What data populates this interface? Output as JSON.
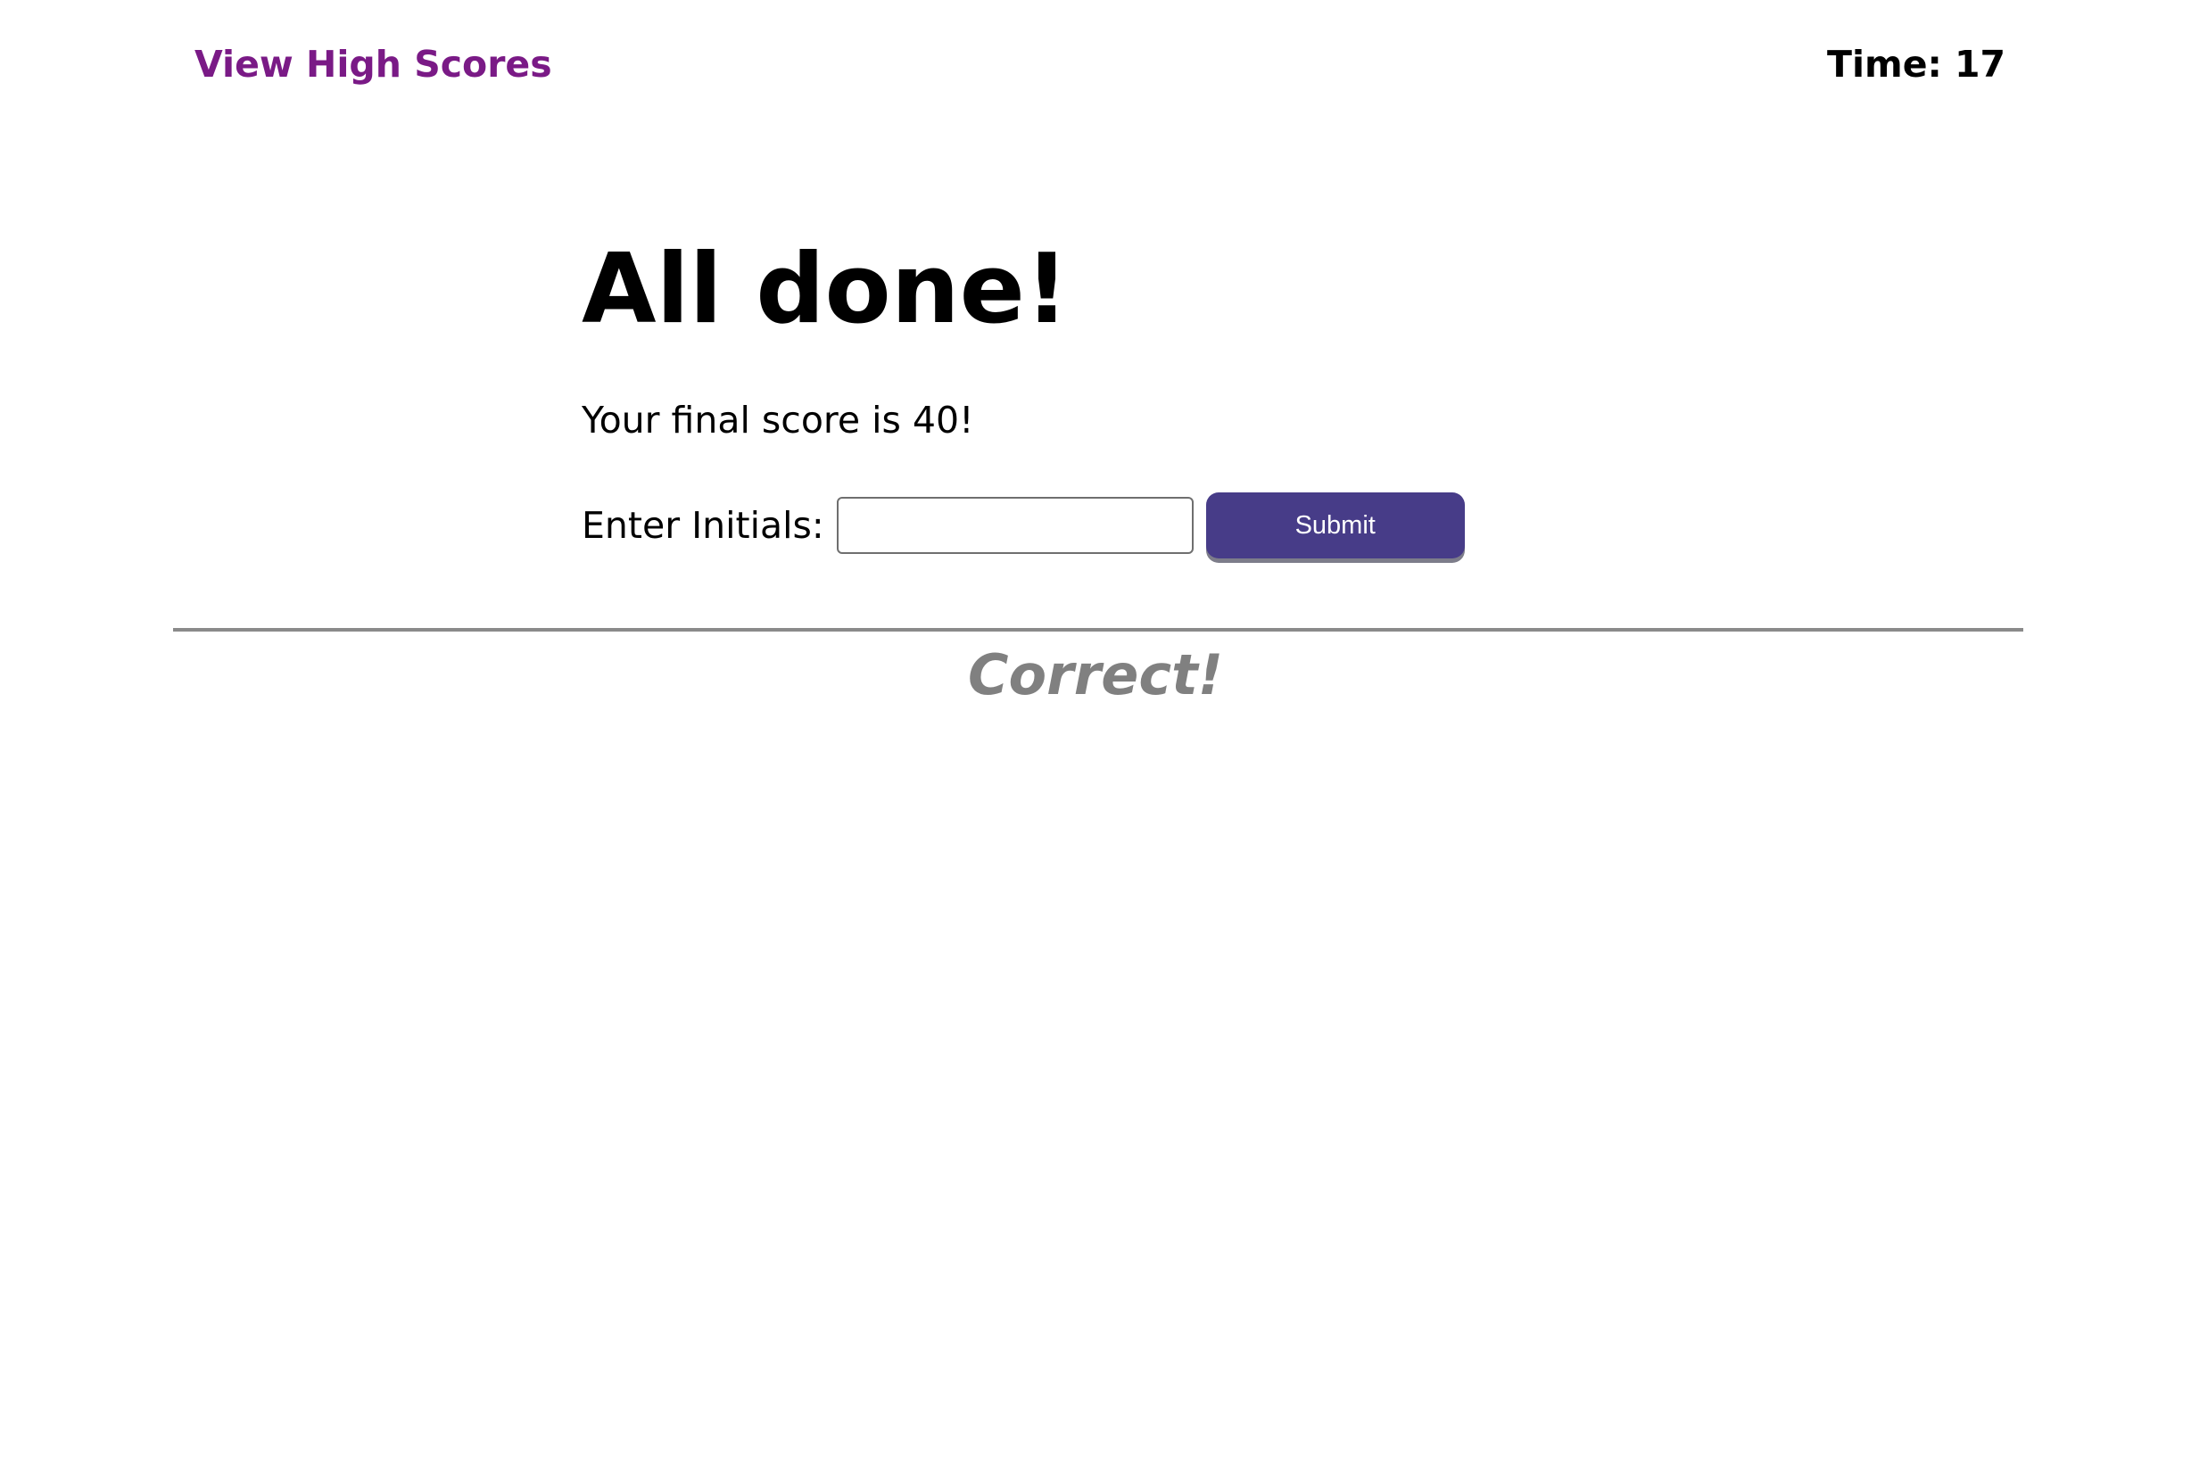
{
  "header": {
    "high_scores_link": "View High Scores",
    "timer_label": "Time:",
    "timer_value": "17"
  },
  "done": {
    "title": "All done!",
    "score_text": "Your final score is 40!",
    "initials_label": "Enter Initials:",
    "initials_value": "",
    "submit_label": "Submit"
  },
  "feedback": {
    "text": "Correct!"
  },
  "colors": {
    "link": "#7a1a86",
    "button": "#473c88",
    "feedback": "#808080",
    "divider": "#8a8a8a"
  }
}
